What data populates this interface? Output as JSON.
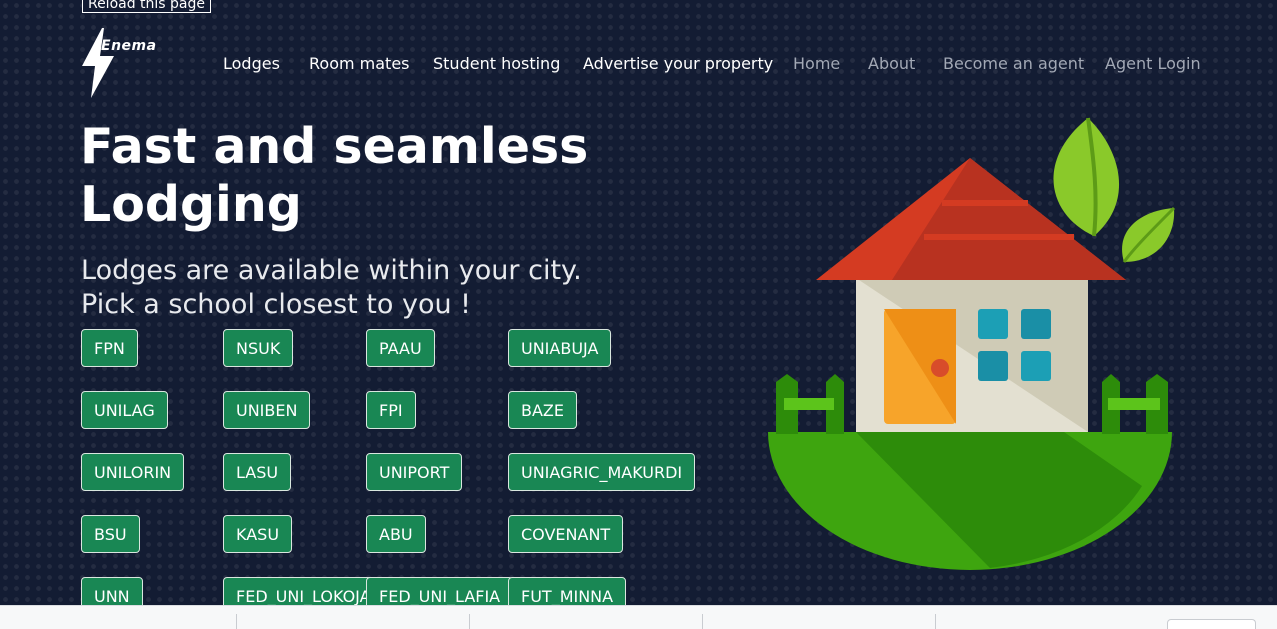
{
  "reload_label": "Reload this page",
  "brand": {
    "name": "Enema"
  },
  "nav": {
    "lodges": "Lodges",
    "roommates": "Room mates",
    "student_hosting": "Student hosting",
    "advertise": "Advertise your property",
    "home": "Home",
    "about": "About",
    "become_agent": "Become an agent",
    "agent_login": "Agent Login"
  },
  "hero": {
    "title_line1": "Fast and seamless",
    "title_line2": "Lodging",
    "subtitle_line1": "Lodges are available within your city.",
    "subtitle_line2": "Pick a school closest to you !"
  },
  "schools": [
    "FPN",
    "NSUK",
    "PAAU",
    "UNIABUJA",
    "UNILAG",
    "UNIBEN",
    "FPI",
    "BAZE",
    "UNILORIN",
    "LASU",
    "UNIPORT",
    "UNIAGRIC_MAKURDI",
    "BSU",
    "KASU",
    "ABU",
    "COVENANT",
    "UNN",
    "FED_UNI_LOKOJA",
    "FED_UNI_LAFIA",
    "FUT_MINNA"
  ],
  "colors": {
    "background": "#131c33",
    "button": "#198754",
    "nav_muted": "#a2a8b5"
  },
  "illustration": "house-on-hill-illustration"
}
